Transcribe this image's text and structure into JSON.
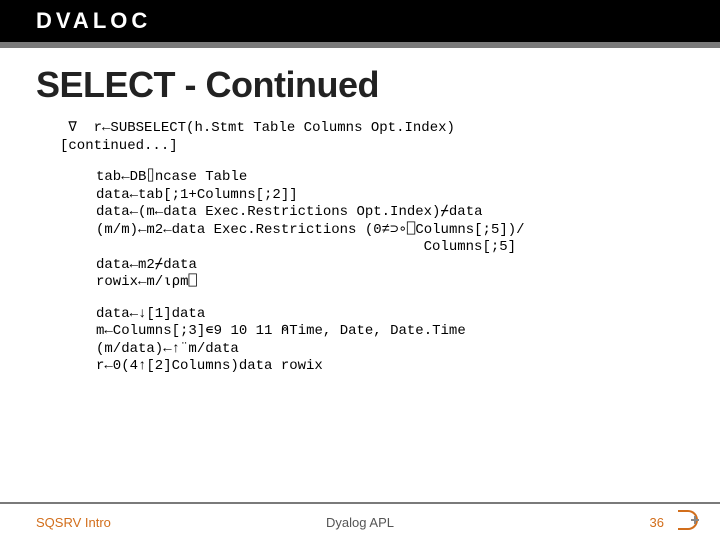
{
  "header": {
    "brand": "DVALOC"
  },
  "title": "SELECT - Continued",
  "code": {
    "block1": " ∇  r←SUBSELECT(h.Stmt Table Columns Opt.Index)\n[continued...]",
    "block2": "tab←DB⌷ncase Table\ndata←tab[;1+Columns[;2]]\ndata←(m←data Exec.Restrictions Opt.Index)⌿data\n(m/m)←m2←data Exec.Restrictions (0≠⊃∘⎕Columns[;5])/\n                                       Columns[;5]\ndata←m2⌿data\nrowix←m/⍳⍴m⎕",
    "block3": "data←↓[1]data\nm←Columns[;3]∊9 10 11 ⍝Time, Date, Date.Time\n(m/data)←↑¨m/data\nr←0(4↑[2]Columns)data rowix"
  },
  "footer": {
    "left": "SQSRV Intro",
    "center": "Dyalog APL",
    "page": "36"
  }
}
